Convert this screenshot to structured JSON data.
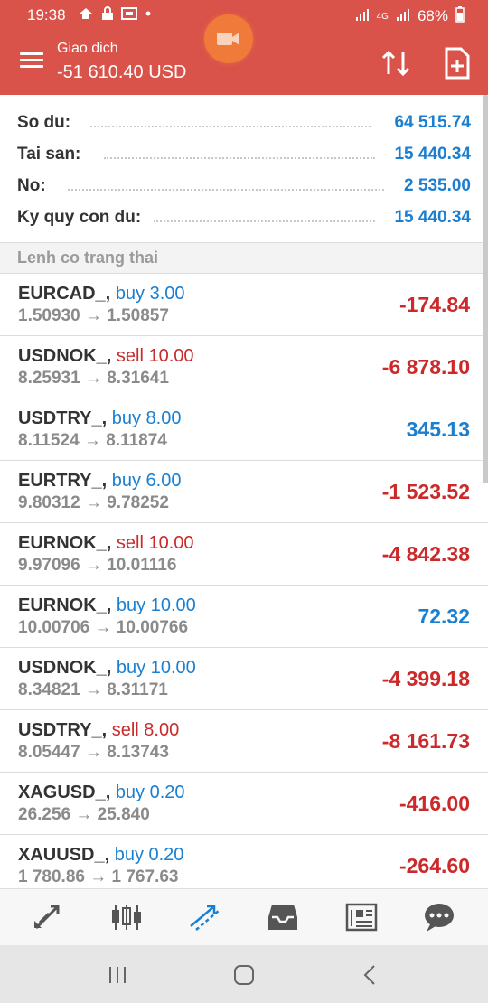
{
  "status_bar": {
    "time": "19:38",
    "network": "4G",
    "battery": "68%"
  },
  "app_bar": {
    "title": "Giao dich",
    "subtitle": "-51 610.40 USD"
  },
  "summary": [
    {
      "label": "So du:",
      "value": "64 515.74"
    },
    {
      "label": "Tai san:",
      "value": "15 440.34"
    },
    {
      "label": "No:",
      "value": "2 535.00"
    },
    {
      "label": "Ky quy con du:",
      "value": "15 440.34"
    }
  ],
  "section_title": "Lenh co trang thai",
  "orders": [
    {
      "symbol": "EURCAD_,",
      "side": "buy",
      "side_text": "buy 3.00",
      "prices": "1.50930 → 1.50857",
      "profit": "-174.84"
    },
    {
      "symbol": "USDNOK_,",
      "side": "sell",
      "side_text": "sell 10.00",
      "prices": "8.25931 → 8.31641",
      "profit": "-6 878.10"
    },
    {
      "symbol": "USDTRY_,",
      "side": "buy",
      "side_text": "buy 8.00",
      "prices": "8.11524 → 8.11874",
      "profit": "345.13"
    },
    {
      "symbol": "EURTRY_,",
      "side": "buy",
      "side_text": "buy 6.00",
      "prices": "9.80312 → 9.78252",
      "profit": "-1 523.52"
    },
    {
      "symbol": "EURNOK_,",
      "side": "sell",
      "side_text": "sell 10.00",
      "prices": "9.97096 → 10.01116",
      "profit": "-4 842.38"
    },
    {
      "symbol": "EURNOK_,",
      "side": "buy",
      "side_text": "buy 10.00",
      "prices": "10.00706 → 10.00766",
      "profit": "72.32"
    },
    {
      "symbol": "USDNOK_,",
      "side": "buy",
      "side_text": "buy 10.00",
      "prices": "8.34821 → 8.31171",
      "profit": "-4 399.18"
    },
    {
      "symbol": "USDTRY_,",
      "side": "sell",
      "side_text": "sell 8.00",
      "prices": "8.05447 → 8.13743",
      "profit": "-8 161.73"
    },
    {
      "symbol": "XAGUSD_,",
      "side": "buy",
      "side_text": "buy 0.20",
      "prices": "26.256 → 25.840",
      "profit": "-416.00"
    },
    {
      "symbol": "XAUUSD_,",
      "side": "buy",
      "side_text": "buy 0.20",
      "prices": "1 780.86 → 1 767.63",
      "profit": "-264.60"
    }
  ],
  "bottom_nav": [
    {
      "icon": "quotes-icon",
      "active": false
    },
    {
      "icon": "chart-icon",
      "active": false
    },
    {
      "icon": "trade-icon",
      "active": true
    },
    {
      "icon": "history-icon",
      "active": false
    },
    {
      "icon": "news-icon",
      "active": false
    },
    {
      "icon": "chat-icon",
      "active": false
    }
  ],
  "colors": {
    "header": "#d9534a",
    "buy": "#1a7fd1",
    "sell": "#cc2a2a"
  }
}
